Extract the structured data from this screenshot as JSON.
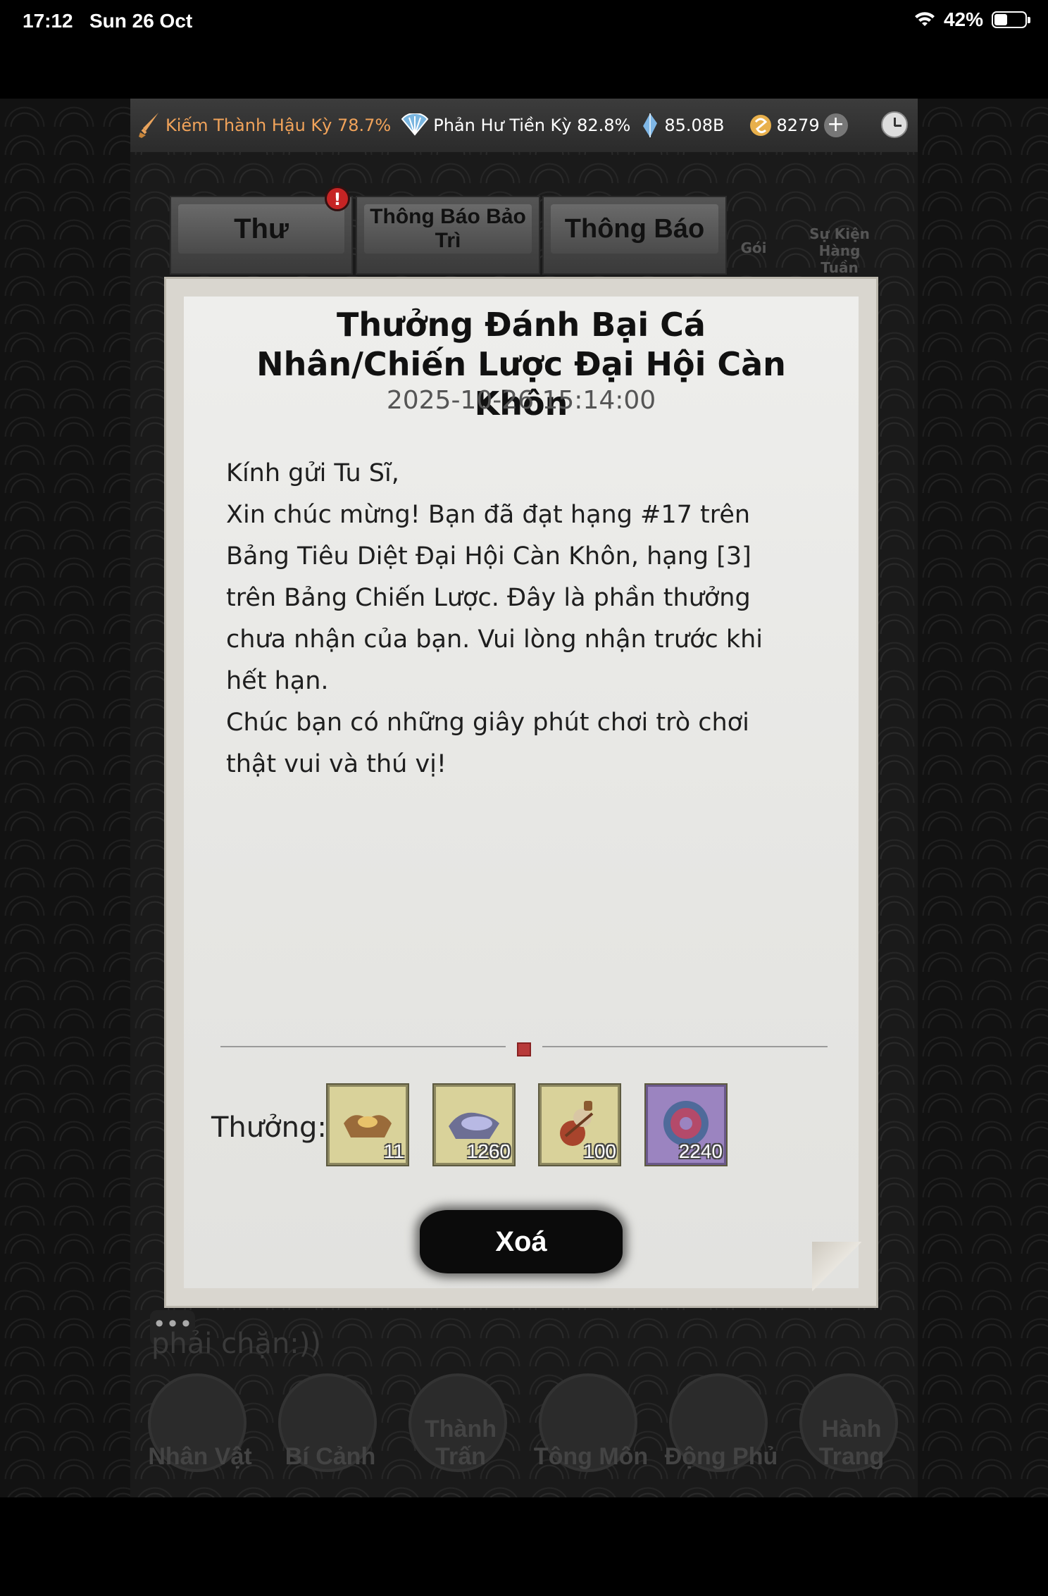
{
  "status_bar": {
    "time": "17:12",
    "date": "Sun 26 Oct",
    "battery": "42%",
    "battery_level": 0.42
  },
  "top_bar": {
    "realm_1": "Kiếm Thành Hậu Kỳ 78.7%",
    "realm_2": "Phản Hư Tiền Kỳ 82.8%",
    "spirit_stones": "85.08B",
    "currency": "8279",
    "plus": "+"
  },
  "tabs": [
    {
      "label": "Thư",
      "badge": "!"
    },
    {
      "label": "Thông Báo Bảo Trì"
    },
    {
      "label": "Thông Báo"
    }
  ],
  "side_tabs": {
    "goi": "Gói",
    "weekly": "Sự Kiện Hàng Tuần"
  },
  "mail": {
    "title": "Thưởng Đánh Bại Cá Nhân/Chiến Lược Đại Hội Càn Khôn",
    "date": "2025-10-26 15:14:00",
    "body": "Kính gửi Tu Sĩ,\nXin chúc mừng! Bạn đã đạt hạng #17 trên Bảng Tiêu Diệt Đại Hội Càn Khôn, hạng [3] trên Bảng Chiến Lược. Đây là phần thưởng chưa nhận của bạn. Vui lòng nhận trước khi hết hạn.\nChúc bạn có những giây phút chơi trò chơi thật vui và thú vị!",
    "reward_label": "Thưởng:",
    "rewards": [
      {
        "count": "11",
        "icon": "gold-ingot-icon"
      },
      {
        "count": "1260",
        "icon": "silver-ingot-icon"
      },
      {
        "count": "100",
        "icon": "gourd-icon"
      },
      {
        "count": "2240",
        "icon": "jade-ring-icon"
      }
    ],
    "delete_label": "Xoá"
  },
  "chat": {
    "dots": "•••",
    "text": "phải chặn:))"
  },
  "bottom_nav": [
    "Nhân Vật",
    "Bí Cảnh",
    "Thành Trấn",
    "Tông Môn",
    "Động Phủ",
    "Hành Trang"
  ]
}
